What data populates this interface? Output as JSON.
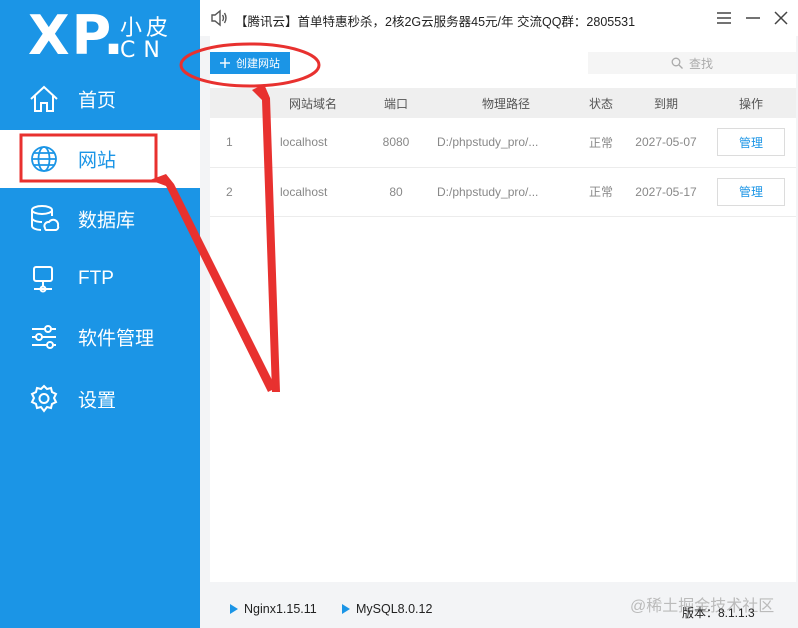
{
  "logo": {
    "main": "XP.",
    "sub1": "小皮",
    "sub2": "CN"
  },
  "nav": [
    {
      "label": "首页",
      "icon": "home-icon"
    },
    {
      "label": "网站",
      "icon": "globe-icon"
    },
    {
      "label": "数据库",
      "icon": "database-icon"
    },
    {
      "label": "FTP",
      "icon": "ftp-icon"
    },
    {
      "label": "软件管理",
      "icon": "sliders-icon"
    },
    {
      "label": "设置",
      "icon": "gear-icon"
    }
  ],
  "topbar": {
    "notice": "【腾讯云】首单特惠秒杀，2核2G云服务器45元/年 交流QQ群：2805531"
  },
  "toolbar": {
    "create_label": "创建网站",
    "search_placeholder": "查找"
  },
  "table": {
    "headers": [
      "网站域名",
      "端口",
      "物理路径",
      "状态",
      "到期",
      "操作"
    ],
    "rows": [
      {
        "index": "1",
        "domain": "localhost",
        "port": "8080",
        "path": "D:/phpstudy_pro/...",
        "status": "正常",
        "expires": "2027-05-07",
        "action": "管理"
      },
      {
        "index": "2",
        "domain": "localhost",
        "port": "80",
        "path": "D:/phpstudy_pro/...",
        "status": "正常",
        "expires": "2027-05-17",
        "action": "管理"
      }
    ]
  },
  "footer": {
    "services": [
      "Nginx1.15.11",
      "MySQL8.0.12"
    ],
    "watermark": "@稀土掘金技术社区",
    "version": "版本：8.1.1.3"
  },
  "colors": {
    "primary": "#1b95e6",
    "annotation": "#e8312f"
  }
}
